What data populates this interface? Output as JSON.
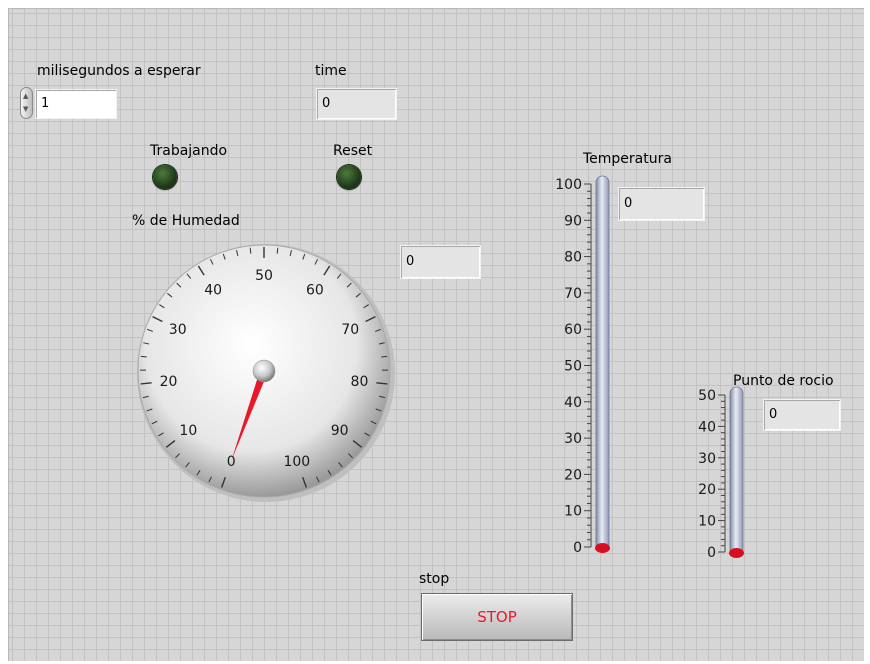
{
  "controls": {
    "ms_wait": {
      "label": "milisegundos a esperar",
      "value": "1"
    },
    "time": {
      "label": "time",
      "value": "0"
    },
    "working": {
      "label": "Trabajando"
    },
    "reset": {
      "label": "Reset"
    },
    "humidity": {
      "label": "% de Humedad",
      "readout": "0",
      "value": 0,
      "scale_min": 0,
      "scale_max": 100,
      "tick_labels": [
        "0",
        "10",
        "20",
        "30",
        "40",
        "50",
        "60",
        "70",
        "80",
        "90",
        "100"
      ]
    },
    "temperature": {
      "label": "Temperatura",
      "readout": "0",
      "value": 0,
      "scale_min": 0,
      "scale_max": 100,
      "tick_labels": [
        "0",
        "10",
        "20",
        "30",
        "40",
        "50",
        "60",
        "70",
        "80",
        "90",
        "100"
      ]
    },
    "dew_point": {
      "label": "Punto de rocio",
      "readout": "0",
      "value": 0,
      "scale_min": 0,
      "scale_max": 50,
      "tick_labels": [
        "0",
        "10",
        "20",
        "30",
        "40",
        "50"
      ]
    },
    "stop": {
      "label": "stop",
      "button_text": "STOP"
    }
  },
  "colors": {
    "panel_bg": "#d6d6d6",
    "grid_line": "#c2c2c2",
    "needle": "#e8182a",
    "led_off": "#2b4a22",
    "stop_text": "#e8182a",
    "mercury": "#d61020"
  },
  "icons": {
    "spinner": "up-down-arrows-icon",
    "led": "led-indicator-icon"
  }
}
